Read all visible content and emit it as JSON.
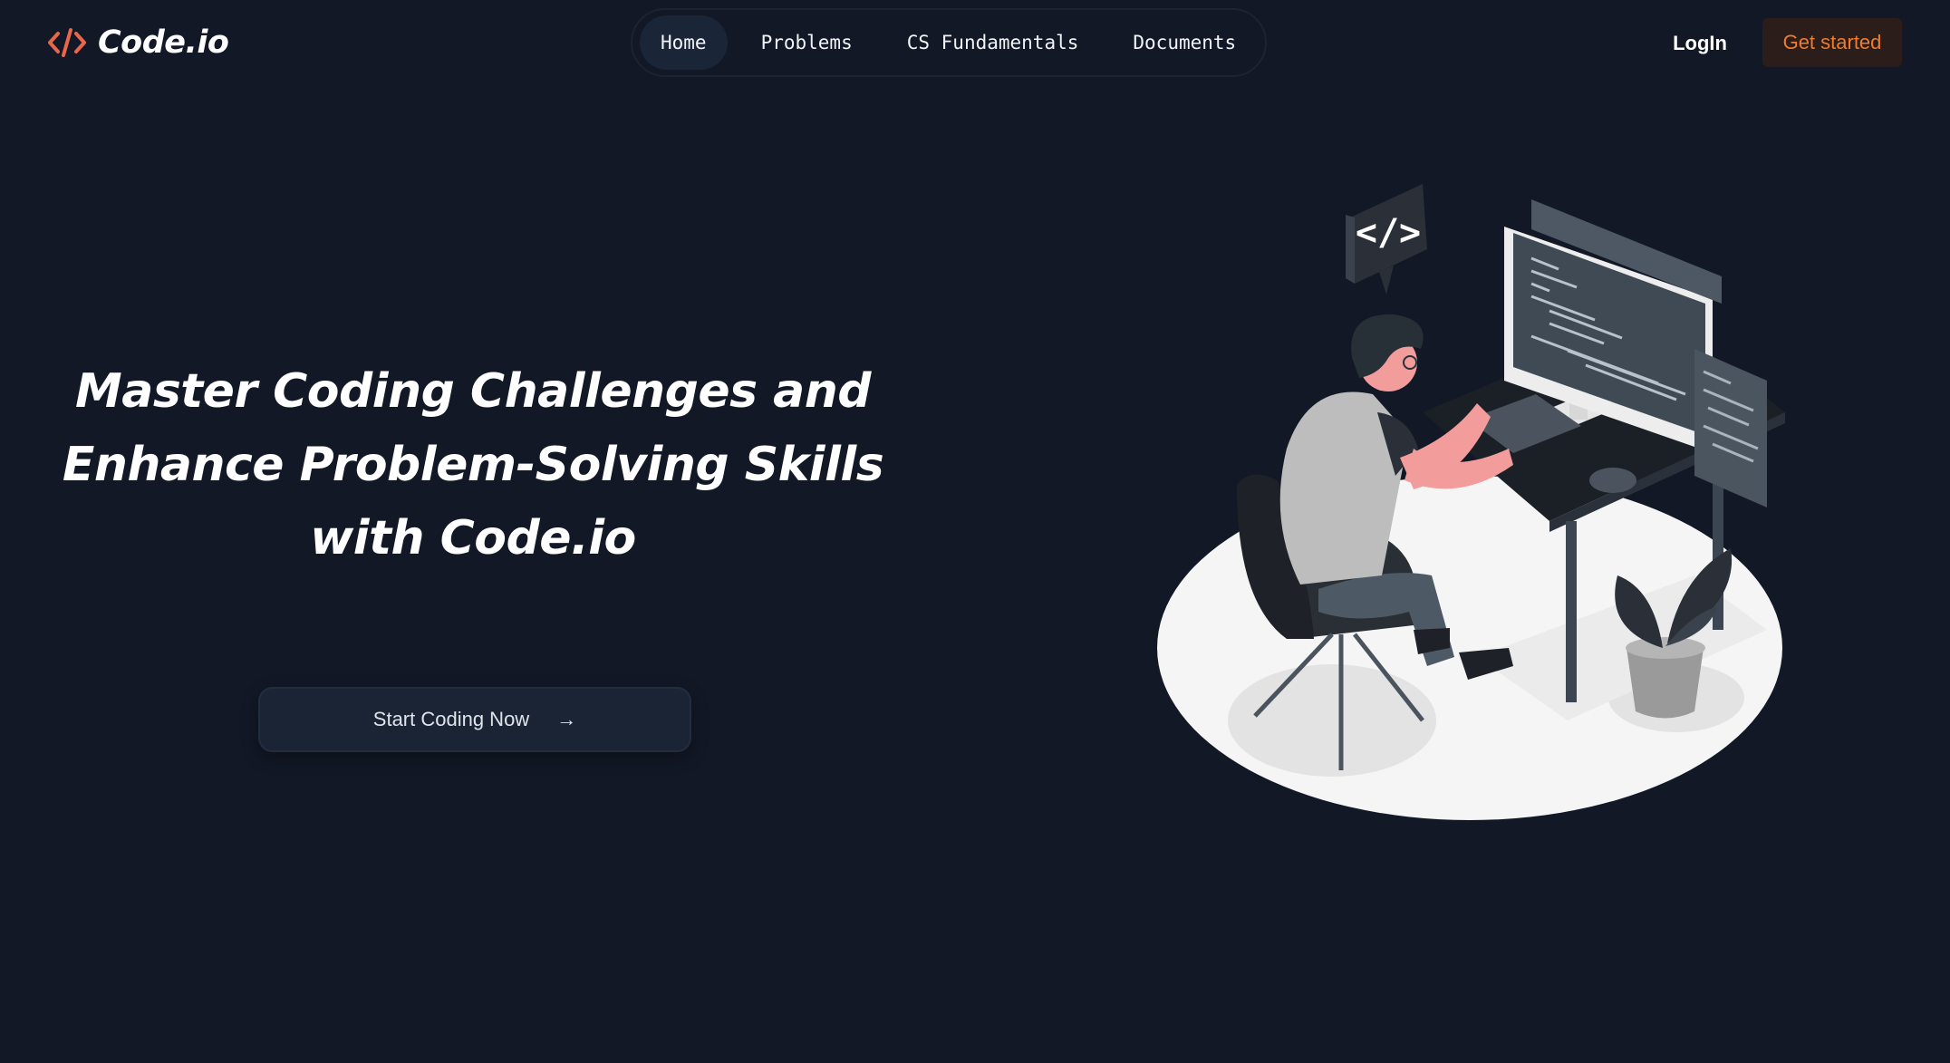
{
  "header": {
    "brand": "Code.io",
    "nav": [
      {
        "label": "Home",
        "active": true
      },
      {
        "label": "Problems",
        "active": false
      },
      {
        "label": "CS Fundamentals",
        "active": false
      },
      {
        "label": "Documents",
        "active": false
      }
    ],
    "login_label": "LogIn",
    "get_started_label": "Get started"
  },
  "hero": {
    "title_lines": [
      "Master Coding Challenges and",
      "Enhance Problem-Solving Skills",
      "with Code.io"
    ],
    "cta_label": "Start Coding Now",
    "cta_arrow": "→",
    "badge_glyph": "</>"
  },
  "colors": {
    "background": "#121826",
    "brand_accent": "#e8674a",
    "get_started_text": "#f07b2e",
    "nav_active_bg": "#1b2538"
  },
  "icons": {
    "logo": "code-brackets-icon",
    "cta_arrow": "arrow-right-icon"
  }
}
